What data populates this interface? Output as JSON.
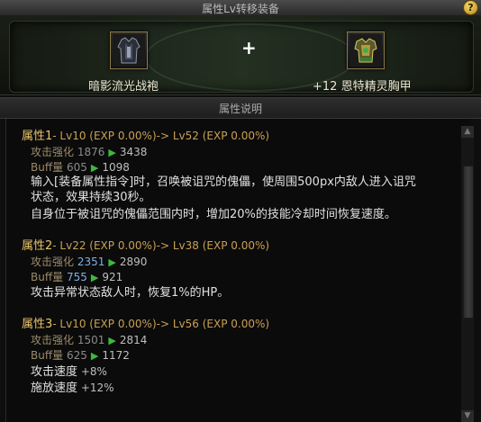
{
  "window": {
    "title": "属性Lv转移装备",
    "help_label": "?"
  },
  "transfer": {
    "source_item": "暗影流光战袍",
    "plus_sign": "+",
    "target_item": "+12 恩特精灵胸甲"
  },
  "section_title": "属性说明",
  "attributes": [
    {
      "name": "属性1",
      "level_text": "- Lv10 (EXP 0.00%)-> Lv52 (EXP 0.00%)",
      "stats": [
        {
          "label": "攻击强化",
          "old": "1876",
          "new": "3438"
        },
        {
          "label": "Buff量",
          "old": "605",
          "new": "1098"
        }
      ],
      "desc": [
        "输入[装备属性指令]时，召唤被诅咒的傀儡，使周围500px内敌人进入诅咒",
        "状态，效果持续30秒。",
        "自身位于被诅咒的傀儡范围内时，增加20%的技能冷却时间恢复速度。"
      ]
    },
    {
      "name": "属性2",
      "level_text": "- Lv22 (EXP 0.00%)-> Lv38 (EXP 0.00%)",
      "stats": [
        {
          "label": "攻击强化",
          "old": "2351",
          "new": "2890"
        },
        {
          "label": "Buff量",
          "old": "755",
          "new": "921"
        }
      ],
      "desc": [
        "攻击异常状态敌人时，恢复1%的HP。"
      ]
    },
    {
      "name": "属性3",
      "level_text": "- Lv10 (EXP 0.00%)-> Lv56 (EXP 0.00%)",
      "stats": [
        {
          "label": "攻击强化",
          "old": "1501",
          "new": "2814"
        },
        {
          "label": "Buff量",
          "old": "625",
          "new": "1172"
        }
      ],
      "extra": [
        {
          "label": "攻击速度",
          "value": "+8%"
        },
        {
          "label": "施放速度",
          "value": "+12%"
        }
      ]
    }
  ],
  "arrow_glyph": "▶",
  "scroll_up_glyph": "▲",
  "scroll_down_glyph": "▼"
}
